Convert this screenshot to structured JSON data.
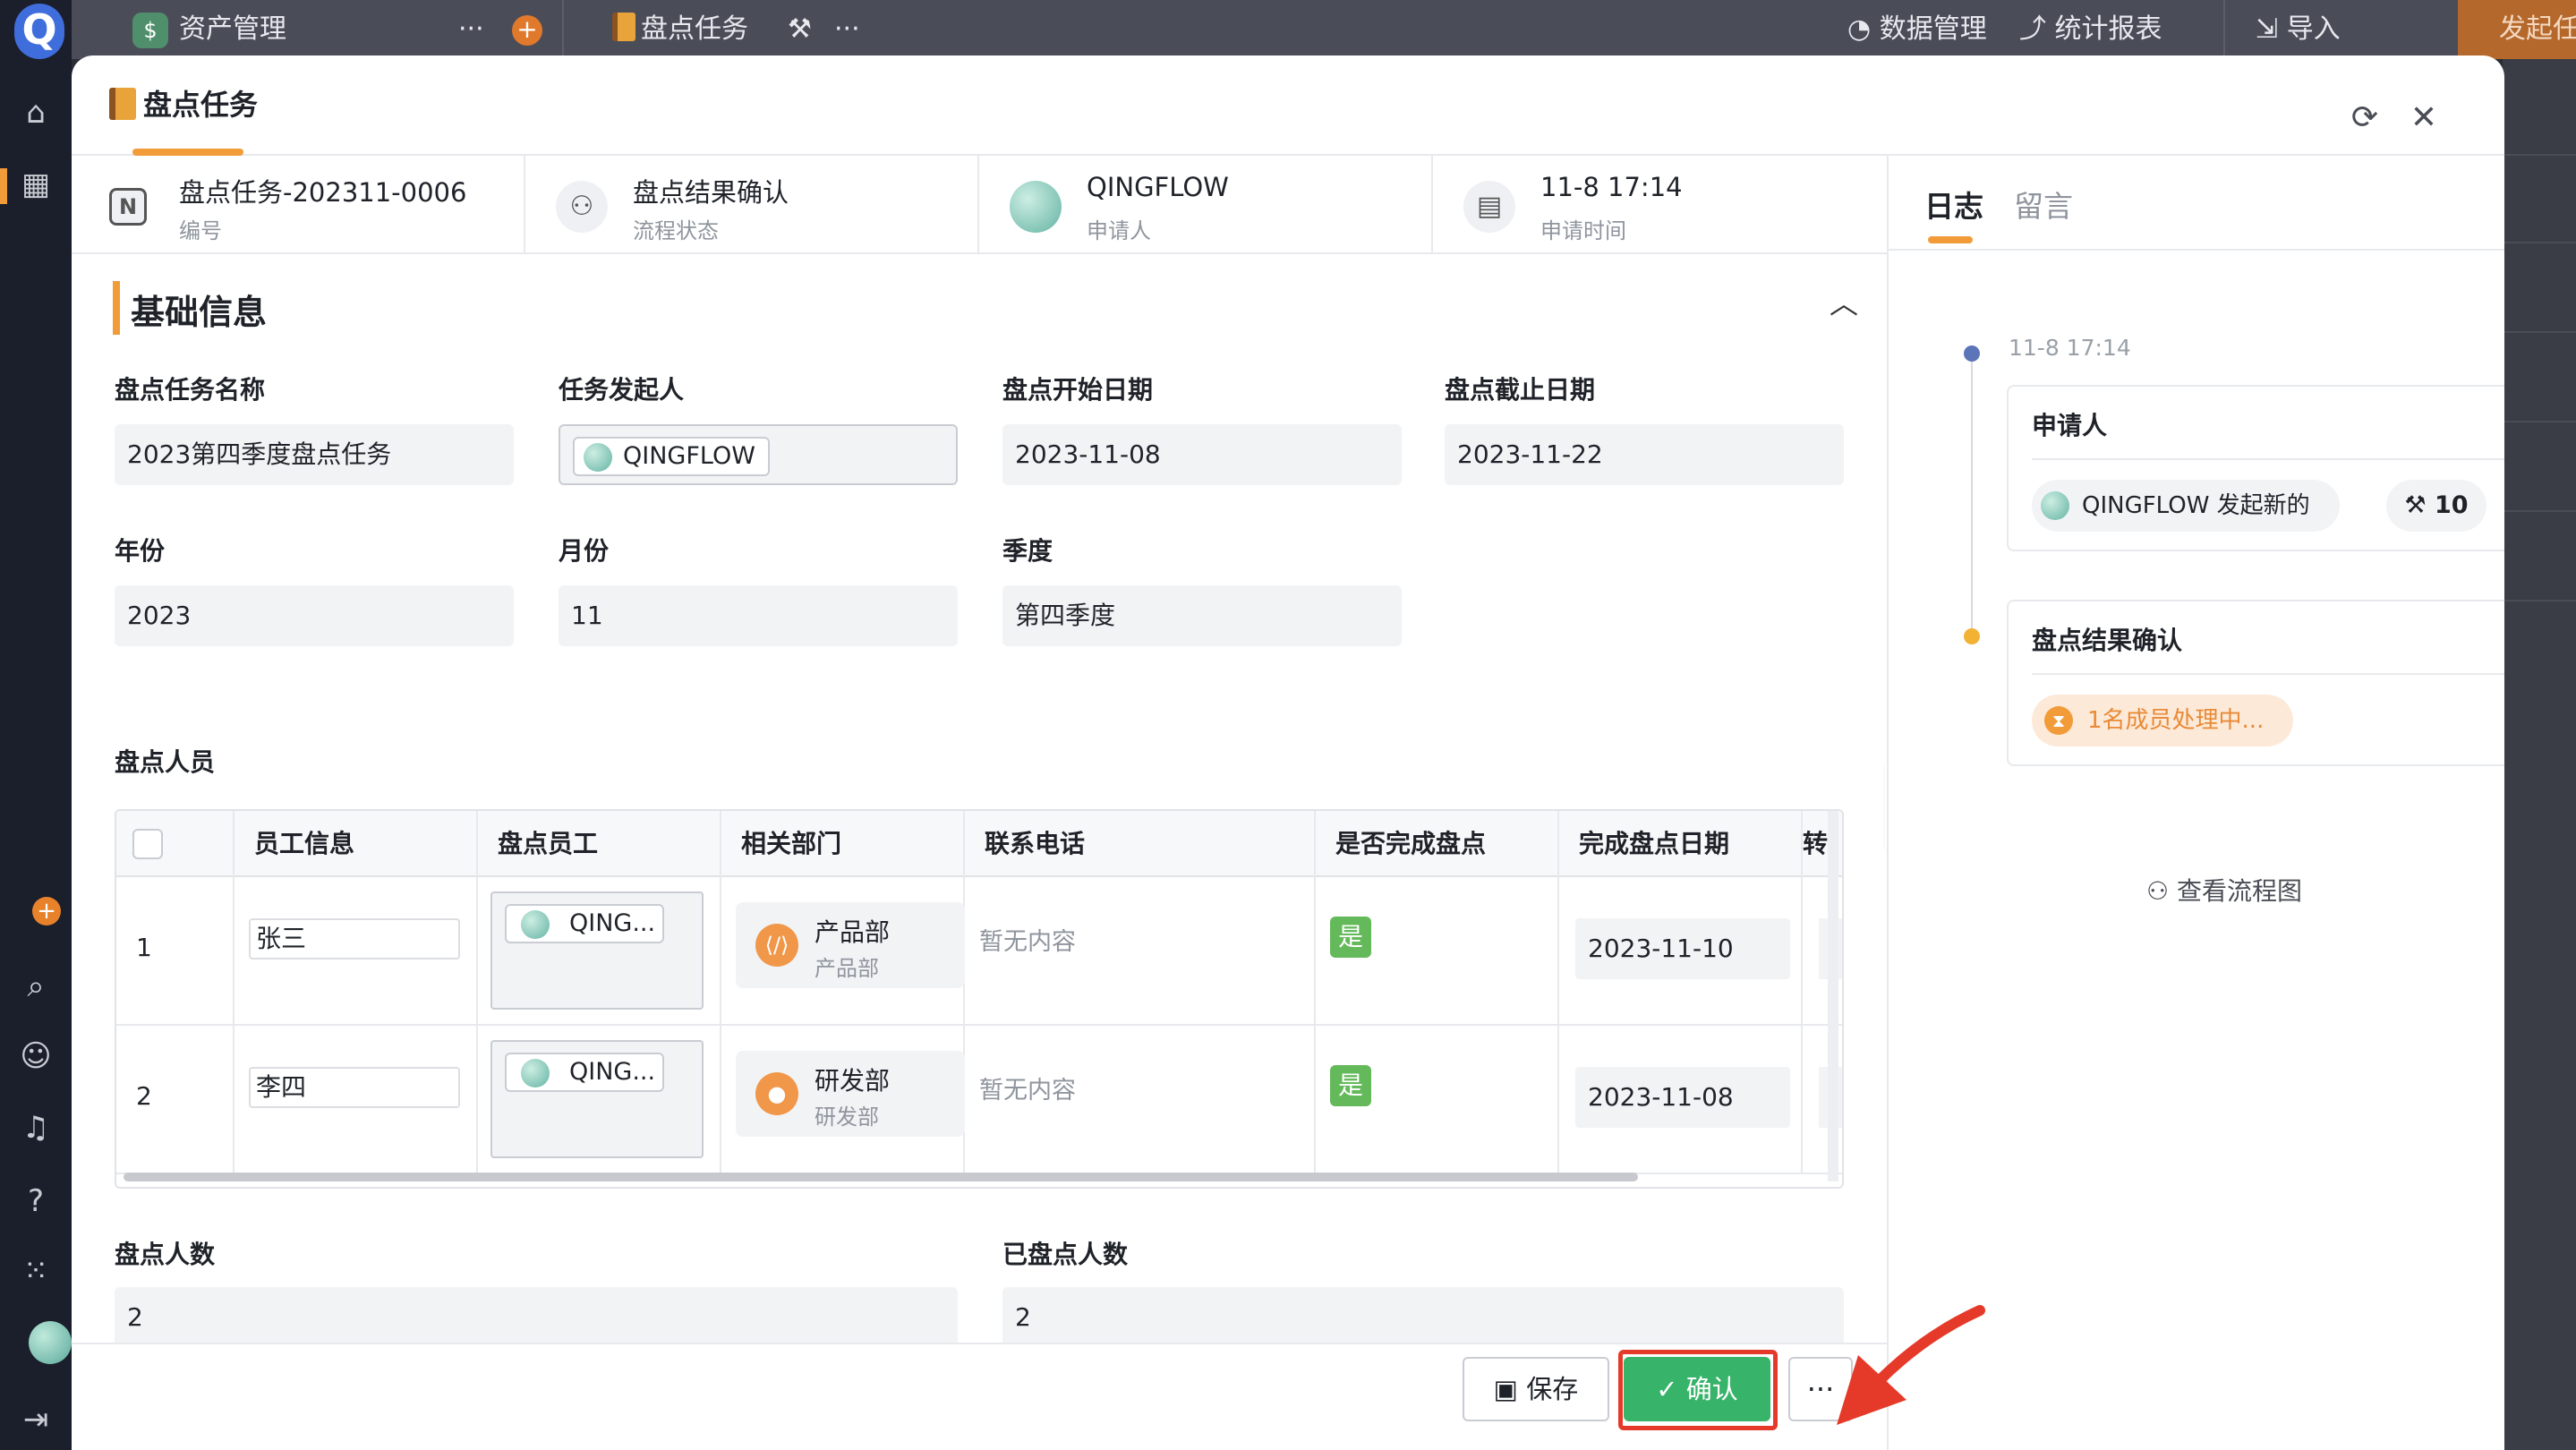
{
  "top_bar": {
    "app_name": "资产管理",
    "app_more": "···",
    "app_plus": "+",
    "tab_name": "盘点任务",
    "tab_more": "···",
    "data_manage": "数据管理",
    "stats_report": "统计报表",
    "import": "导入",
    "launch_task": "发起任务"
  },
  "modal": {
    "title": "盘点任务",
    "info": [
      {
        "main": "盘点任务-202311-0006",
        "sub": "编号",
        "icon": "N"
      },
      {
        "main": "盘点结果确认",
        "sub": "流程状态",
        "icon": "flow"
      },
      {
        "main": "QINGFLOW",
        "sub": "申请人",
        "icon": "avatar"
      },
      {
        "main": "11-8 17:14",
        "sub": "申请时间",
        "icon": "calendar"
      }
    ],
    "section_title": "基础信息",
    "fields": {
      "task_name_label": "盘点任务名称",
      "task_name_value": "2023第四季度盘点任务",
      "initiator_label": "任务发起人",
      "initiator_value": "QINGFLOW",
      "start_date_label": "盘点开始日期",
      "start_date_value": "2023-11-08",
      "end_date_label": "盘点截止日期",
      "end_date_value": "2023-11-22",
      "year_label": "年份",
      "year_value": "2023",
      "month_label": "月份",
      "month_value": "11",
      "quarter_label": "季度",
      "quarter_value": "第四季度",
      "staff_label": "盘点人员",
      "count_label": "盘点人数",
      "count_value": "2",
      "done_count_label": "已盘点人数",
      "done_count_value": "2"
    },
    "table": {
      "headers": [
        "员工信息",
        "盘点员工",
        "相关部门",
        "联系电话",
        "是否完成盘点",
        "完成盘点日期",
        "转"
      ],
      "rows": [
        {
          "index": "1",
          "name": "张三",
          "employee": "QING...",
          "dept": "产品部",
          "dept_sub": "产品部",
          "phone": "暂无内容",
          "done": "是",
          "date": "2023-11-10"
        },
        {
          "index": "2",
          "name": "李四",
          "employee": "QING...",
          "dept": "研发部",
          "dept_sub": "研发部",
          "phone": "暂无内容",
          "done": "是",
          "date": "2023-11-08"
        }
      ]
    },
    "footer": {
      "save": "保存",
      "confirm": "确认",
      "more": "···"
    }
  },
  "right_pane": {
    "tab_log": "日志",
    "tab_comment": "留言",
    "time": "11-8 17:14",
    "card1_title": "申请人",
    "card1_chip": "QINGFLOW 发起新的",
    "card1_count": "10",
    "card2_title": "盘点结果确认",
    "card2_chip": "1名成员处理中...",
    "flow_link": "查看流程图"
  },
  "colors": {
    "accent": "#f29b39",
    "confirm_green": "#38b36a",
    "highlight_red": "#e53a2a",
    "yes_green": "#64b95a"
  }
}
